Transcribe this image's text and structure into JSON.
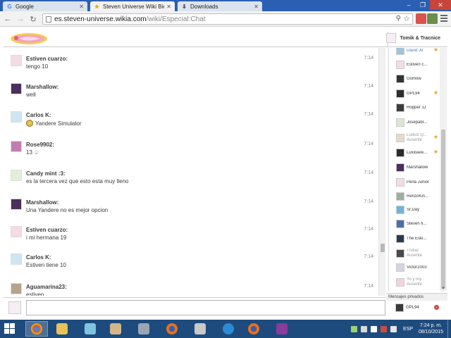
{
  "browser": {
    "tabs": [
      {
        "label": "Google",
        "icon": "google-g-icon",
        "active": false
      },
      {
        "label": "Steven Universe Wiki Bie",
        "icon": "wikia-star-icon",
        "active": true
      },
      {
        "label": "Downloads",
        "icon": "download-icon",
        "active": false
      }
    ],
    "url_host": "es.steven-universe.wikia.com",
    "url_path": "/wiki/Especial:Chat"
  },
  "chat": {
    "self_name": "Tomik & Tracnice",
    "messages": [
      {
        "author": "Estiven cuarzo:",
        "text": "tengo 10",
        "time": "7:14",
        "avatar_color": "#f4dbe6",
        "emoji": false
      },
      {
        "author": "Marshallow:",
        "text": "well",
        "time": "7:14",
        "avatar_color": "#4b2f5c",
        "emoji": false
      },
      {
        "author": "Carlos K:",
        "text": "Yandere Simulator",
        "time": "7:14",
        "avatar_color": "#cde6f1",
        "emoji": true
      },
      {
        "author": "Rose9902:",
        "text": "13 ♤",
        "time": "7:14",
        "avatar_color": "#c47ab2",
        "emoji": false
      },
      {
        "author": "Candy mint :3:",
        "text": "es la tercera vez que esto esta muy lleno",
        "time": "7:14",
        "avatar_color": "#dff0d6",
        "emoji": false
      },
      {
        "author": "Marshallow:",
        "text": "Una Yandere no es mejor opcion",
        "time": "7:14",
        "avatar_color": "#4b2f5c",
        "emoji": false
      },
      {
        "author": "Estiven cuarzo:",
        "text": "i mi hermana 19",
        "time": "7:14",
        "avatar_color": "#f4dbe6",
        "emoji": false
      },
      {
        "author": "Carlos K:",
        "text": "Estiven tiene 10",
        "time": "7:14",
        "avatar_color": "#cde6f1",
        "emoji": false
      },
      {
        "author": "Aguamarina23:",
        "text": "estiven",
        "time": "7:14",
        "avatar_color": "#b5a38c",
        "emoji": false
      }
    ],
    "users": [
      {
        "name": "David Jo",
        "sub": "",
        "star": true,
        "away": false,
        "color": "#9fc4d9"
      },
      {
        "name": "Estiven c...",
        "sub": "",
        "star": false,
        "away": false,
        "color": "#f4dbe6"
      },
      {
        "name": "Gomow",
        "sub": "",
        "star": false,
        "away": false,
        "color": "#333333"
      },
      {
        "name": "GPL94",
        "sub": "",
        "star": true,
        "away": false,
        "color": "#2d2d2d"
      },
      {
        "name": "Hopper :D",
        "sub": "",
        "star": false,
        "away": false,
        "color": "#3c3c3c"
      },
      {
        "name": "Josepabl...",
        "sub": "",
        "star": false,
        "away": false,
        "color": "#dbe7d0"
      },
      {
        "name": "Ludius Q...",
        "sub": "Ausente",
        "star": true,
        "away": true,
        "color": "#e8d9c8"
      },
      {
        "name": "Luxioave...",
        "sub": "",
        "star": true,
        "away": false,
        "color": "#2a2a2a"
      },
      {
        "name": "Marshallow",
        "sub": "",
        "star": false,
        "away": false,
        "color": "#4b2f5c"
      },
      {
        "name": "Perla Junior",
        "sub": "",
        "star": false,
        "away": false,
        "color": "#f4dbe6"
      },
      {
        "name": "RenzoKin...",
        "sub": "",
        "star": false,
        "away": false,
        "color": "#9bb0a2"
      },
      {
        "name": "Sr.Day",
        "sub": "",
        "star": false,
        "away": false,
        "color": "#6fb4d8"
      },
      {
        "name": "Steven fi...",
        "sub": "",
        "star": false,
        "away": false,
        "color": "#4c6fa6"
      },
      {
        "name": "The Eski...",
        "sub": "",
        "star": false,
        "away": false,
        "color": "#2b3a4f"
      },
      {
        "name": "Trufas",
        "sub": "Ausente",
        "star": false,
        "away": true,
        "color": "#4a4a4a"
      },
      {
        "name": "Victor2003",
        "sub": "",
        "star": false,
        "away": false,
        "color": "#d8d3e0"
      },
      {
        "name": "Yo y my",
        "sub": "Ausente",
        "star": false,
        "away": true,
        "color": "#f1d4df"
      }
    ],
    "private_header": "Mensajes privados",
    "private_user": "GPL94",
    "private_badge": "x"
  },
  "taskbar": {
    "apps": [
      "chrome-icon",
      "file-explorer-icon",
      "notepad-icon",
      "paint-icon",
      "calculator-icon",
      "firefox-icon",
      "zsnes-icon",
      "ie-icon",
      "firefox-alt-icon",
      "winrar-icon"
    ],
    "lang": "ESP",
    "time": "7:24 p. m.",
    "date": "08/10/2015"
  },
  "colors": {
    "tabstrip": "#2b5fb3",
    "taskbar": "#1e4b7d",
    "star": "#e8a21d"
  }
}
